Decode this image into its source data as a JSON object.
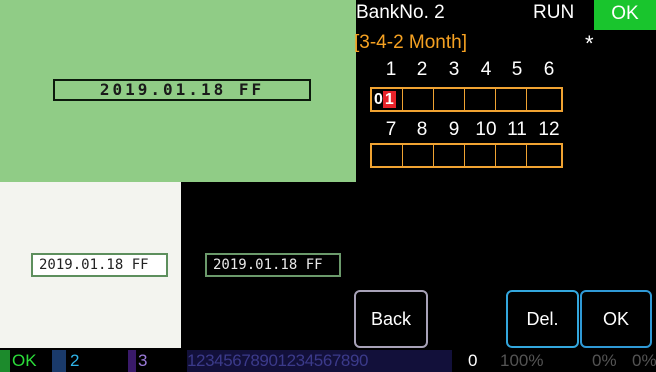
{
  "preview": {
    "lcd_text": "2019.01.18 FF",
    "light_date": "2019.01.18  FF",
    "dark_date": "2019.01.18  FF"
  },
  "settings": {
    "bank_label": "BankNo. 2",
    "run_label": "RUN",
    "ok_status": "OK",
    "mode_label": "[3-4-2 Month]",
    "asterisk": "*",
    "months_row1": [
      "1",
      "2",
      "3",
      "4",
      "5",
      "6"
    ],
    "months_row2": [
      "7",
      "8",
      "9",
      "10",
      "11",
      "12"
    ],
    "cursor_prefix": "0",
    "cursor_digit": "1"
  },
  "buttons": {
    "back": "Back",
    "del": "Del.",
    "ok": "OK"
  },
  "statusbar": {
    "ok": "OK",
    "page2": "2",
    "page3": "3",
    "ticker": "12345678901234567890",
    "zero": "0",
    "pct1": "100%",
    "pct2": "0%",
    "pct3": "0%"
  },
  "colors": {
    "accent_orange": "#f0a332",
    "ok_green": "#19c52d",
    "button_blue": "#33a7de"
  }
}
